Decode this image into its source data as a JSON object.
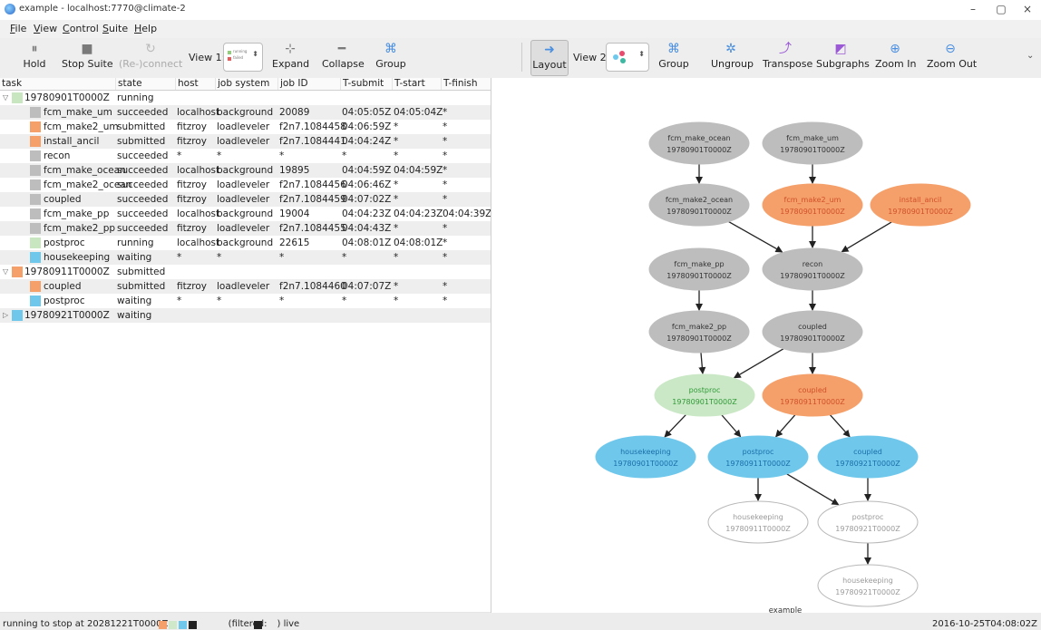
{
  "window": {
    "title": "example - localhost:7770@climate-2",
    "min_glyph": "–",
    "max_glyph": "▢",
    "close_glyph": "×"
  },
  "menu": [
    "File",
    "View",
    "Control",
    "Suite",
    "Help"
  ],
  "toolbar": {
    "hold": "Hold",
    "stop_suite": "Stop Suite",
    "reconnect": "(Re-)connect",
    "view1": "View 1:",
    "expand": "Expand",
    "collapse": "Collapse",
    "group_left": "Group",
    "layout": "Layout",
    "view2": "View 2:",
    "group": "Group",
    "ungroup": "Ungroup",
    "transpose": "Transpose",
    "subgraphs": "Subgraphs",
    "zoom_in": "Zoom In",
    "zoom_out": "Zoom Out",
    "view1_option_lines": [
      "running",
      "failed"
    ]
  },
  "table": {
    "headers": [
      "task",
      "state",
      "host",
      "job system",
      "job ID",
      "T-submit",
      "T-start",
      "T-finish"
    ],
    "rows": [
      {
        "indent": 0,
        "exp": "▽",
        "color": "#c8e6c0",
        "task": "19780901T0000Z",
        "state": "running",
        "host": "",
        "jobsys": "",
        "jobid": "",
        "tsub": "",
        "tstart": "",
        "tfin": ""
      },
      {
        "indent": 1,
        "exp": "",
        "color": "#bdbdbd",
        "task": "fcm_make_um",
        "state": "succeeded",
        "host": "localhost",
        "jobsys": "background",
        "jobid": "20089",
        "tsub": "04:05:05Z",
        "tstart": "04:05:04Z",
        "tfin": "*"
      },
      {
        "indent": 1,
        "exp": "",
        "color": "#f5a06a",
        "task": "fcm_make2_um",
        "state": "submitted",
        "host": "fitzroy",
        "jobsys": "loadleveler",
        "jobid": "f2n7.1084458",
        "tsub": "04:06:59Z",
        "tstart": "*",
        "tfin": "*"
      },
      {
        "indent": 1,
        "exp": "",
        "color": "#f5a06a",
        "task": "install_ancil",
        "state": "submitted",
        "host": "fitzroy",
        "jobsys": "loadleveler",
        "jobid": "f2n7.1084441",
        "tsub": "04:04:24Z",
        "tstart": "*",
        "tfin": "*"
      },
      {
        "indent": 1,
        "exp": "",
        "color": "#bdbdbd",
        "task": "recon",
        "state": "succeeded",
        "host": "*",
        "jobsys": "*",
        "jobid": "*",
        "tsub": "*",
        "tstart": "*",
        "tfin": "*"
      },
      {
        "indent": 1,
        "exp": "",
        "color": "#bdbdbd",
        "task": "fcm_make_ocean",
        "state": "succeeded",
        "host": "localhost",
        "jobsys": "background",
        "jobid": "19895",
        "tsub": "04:04:59Z",
        "tstart": "04:04:59Z",
        "tfin": "*"
      },
      {
        "indent": 1,
        "exp": "",
        "color": "#bdbdbd",
        "task": "fcm_make2_ocean",
        "state": "succeeded",
        "host": "fitzroy",
        "jobsys": "loadleveler",
        "jobid": "f2n7.1084456",
        "tsub": "04:06:46Z",
        "tstart": "*",
        "tfin": "*"
      },
      {
        "indent": 1,
        "exp": "",
        "color": "#bdbdbd",
        "task": "coupled",
        "state": "succeeded",
        "host": "fitzroy",
        "jobsys": "loadleveler",
        "jobid": "f2n7.1084459",
        "tsub": "04:07:02Z",
        "tstart": "*",
        "tfin": "*"
      },
      {
        "indent": 1,
        "exp": "",
        "color": "#bdbdbd",
        "task": "fcm_make_pp",
        "state": "succeeded",
        "host": "localhost",
        "jobsys": "background",
        "jobid": "19004",
        "tsub": "04:04:23Z",
        "tstart": "04:04:23Z",
        "tfin": "04:04:39Z"
      },
      {
        "indent": 1,
        "exp": "",
        "color": "#bdbdbd",
        "task": "fcm_make2_pp",
        "state": "succeeded",
        "host": "fitzroy",
        "jobsys": "loadleveler",
        "jobid": "f2n7.1084455",
        "tsub": "04:04:43Z",
        "tstart": "*",
        "tfin": "*"
      },
      {
        "indent": 1,
        "exp": "",
        "color": "#c8e6c0",
        "task": "postproc",
        "state": "running",
        "host": "localhost",
        "jobsys": "background",
        "jobid": "22615",
        "tsub": "04:08:01Z",
        "tstart": "04:08:01Z",
        "tfin": "*"
      },
      {
        "indent": 1,
        "exp": "",
        "color": "#6fc8ec",
        "task": "housekeeping",
        "state": "waiting",
        "host": "*",
        "jobsys": "*",
        "jobid": "*",
        "tsub": "*",
        "tstart": "*",
        "tfin": "*"
      },
      {
        "indent": 0,
        "exp": "▽",
        "color": "#f5a06a",
        "task": "19780911T0000Z",
        "state": "submitted",
        "host": "",
        "jobsys": "",
        "jobid": "",
        "tsub": "",
        "tstart": "",
        "tfin": ""
      },
      {
        "indent": 1,
        "exp": "",
        "color": "#f5a06a",
        "task": "coupled",
        "state": "submitted",
        "host": "fitzroy",
        "jobsys": "loadleveler",
        "jobid": "f2n7.1084460",
        "tsub": "04:07:07Z",
        "tstart": "*",
        "tfin": "*"
      },
      {
        "indent": 1,
        "exp": "",
        "color": "#6fc8ec",
        "task": "postproc",
        "state": "waiting",
        "host": "*",
        "jobsys": "*",
        "jobid": "*",
        "tsub": "*",
        "tstart": "*",
        "tfin": "*"
      },
      {
        "indent": 0,
        "exp": "▷",
        "color": "#6fc8ec",
        "task": "19780921T0000Z",
        "state": "waiting",
        "host": "",
        "jobsys": "",
        "jobid": "",
        "tsub": "",
        "tstart": "",
        "tfin": ""
      }
    ]
  },
  "graph": {
    "caption": "example",
    "nodes": [
      {
        "id": "fcm_make_ocean_01",
        "name": "fcm_make_ocean",
        "cycle": "19780901T0000Z",
        "state": "succeeded"
      },
      {
        "id": "fcm_make_um_01",
        "name": "fcm_make_um",
        "cycle": "19780901T0000Z",
        "state": "succeeded"
      },
      {
        "id": "fcm_make2_ocean_01",
        "name": "fcm_make2_ocean",
        "cycle": "19780901T0000Z",
        "state": "succeeded"
      },
      {
        "id": "fcm_make2_um_01",
        "name": "fcm_make2_um",
        "cycle": "19780901T0000Z",
        "state": "submitted"
      },
      {
        "id": "install_ancil_01",
        "name": "install_ancil",
        "cycle": "19780901T0000Z",
        "state": "submitted"
      },
      {
        "id": "fcm_make_pp_01",
        "name": "fcm_make_pp",
        "cycle": "19780901T0000Z",
        "state": "succeeded"
      },
      {
        "id": "recon_01",
        "name": "recon",
        "cycle": "19780901T0000Z",
        "state": "succeeded"
      },
      {
        "id": "fcm_make2_pp_01",
        "name": "fcm_make2_pp",
        "cycle": "19780901T0000Z",
        "state": "succeeded"
      },
      {
        "id": "coupled_01",
        "name": "coupled",
        "cycle": "19780901T0000Z",
        "state": "succeeded"
      },
      {
        "id": "postproc_01",
        "name": "postproc",
        "cycle": "19780901T0000Z",
        "state": "running"
      },
      {
        "id": "coupled_11",
        "name": "coupled",
        "cycle": "19780911T0000Z",
        "state": "submitted"
      },
      {
        "id": "housekeeping_01",
        "name": "housekeeping",
        "cycle": "19780901T0000Z",
        "state": "waiting"
      },
      {
        "id": "postproc_11",
        "name": "postproc",
        "cycle": "19780911T0000Z",
        "state": "waiting"
      },
      {
        "id": "coupled_21",
        "name": "coupled",
        "cycle": "19780921T0000Z",
        "state": "waiting"
      },
      {
        "id": "housekeeping_11",
        "name": "housekeeping",
        "cycle": "19780911T0000Z",
        "state": "runahead"
      },
      {
        "id": "postproc_21",
        "name": "postproc",
        "cycle": "19780921T0000Z",
        "state": "runahead"
      },
      {
        "id": "housekeeping_21",
        "name": "housekeeping",
        "cycle": "19780921T0000Z",
        "state": "runahead"
      }
    ],
    "edges": [
      [
        "fcm_make_ocean_01",
        "fcm_make2_ocean_01"
      ],
      [
        "fcm_make_um_01",
        "fcm_make2_um_01"
      ],
      [
        "fcm_make2_ocean_01",
        "recon_01"
      ],
      [
        "fcm_make2_um_01",
        "recon_01"
      ],
      [
        "install_ancil_01",
        "recon_01"
      ],
      [
        "fcm_make_pp_01",
        "fcm_make2_pp_01"
      ],
      [
        "recon_01",
        "coupled_01"
      ],
      [
        "fcm_make2_pp_01",
        "postproc_01"
      ],
      [
        "coupled_01",
        "postproc_01"
      ],
      [
        "coupled_01",
        "coupled_11"
      ],
      [
        "postproc_01",
        "housekeeping_01"
      ],
      [
        "postproc_01",
        "postproc_11"
      ],
      [
        "coupled_11",
        "postproc_11"
      ],
      [
        "coupled_11",
        "coupled_21"
      ],
      [
        "postproc_11",
        "housekeeping_11"
      ],
      [
        "postproc_11",
        "postproc_21"
      ],
      [
        "coupled_21",
        "postproc_21"
      ],
      [
        "postproc_21",
        "housekeeping_21"
      ]
    ]
  },
  "state_colors": {
    "succeeded": {
      "fill": "#bdbdbd",
      "stroke": "#bdbdbd",
      "text": "#333333"
    },
    "submitted": {
      "fill": "#f5a06a",
      "stroke": "#f5a06a",
      "text": "#d0502a"
    },
    "running": {
      "fill": "#cbe8c6",
      "stroke": "#cbe8c6",
      "text": "#2f9a37"
    },
    "waiting": {
      "fill": "#6fc8ec",
      "stroke": "#6fc8ec",
      "text": "#1b6ea8"
    },
    "runahead": {
      "fill": "#ffffff",
      "stroke": "#b8b8b8",
      "text": "#9a9a9a"
    }
  },
  "status": {
    "text_left": "running to stop at 20281221T0000Z",
    "filtered": "(filtered:",
    "filtered_close": ")",
    "live": "live",
    "time": "2016-10-25T04:08:02Z"
  }
}
